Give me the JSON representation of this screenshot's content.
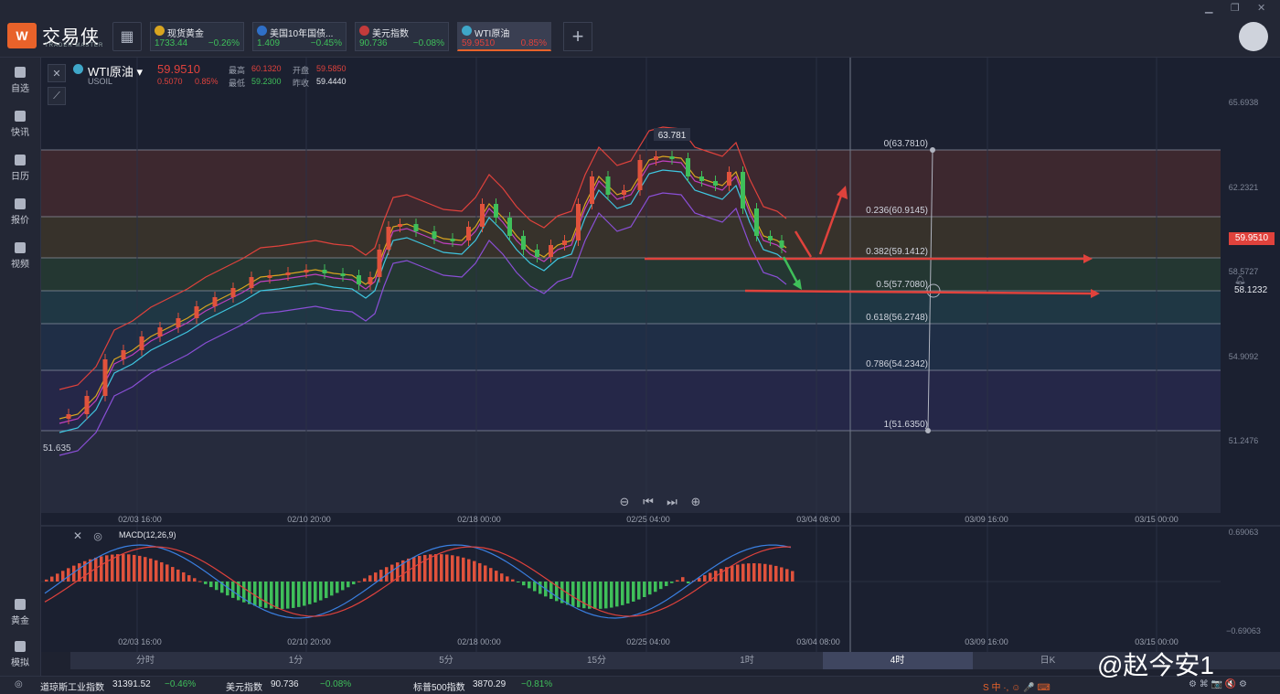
{
  "app": {
    "name": "交易侠",
    "sub": "TRADER MASTER"
  },
  "tabs": [
    {
      "name": "现货黄金",
      "price": "1733.44",
      "change": "−0.26%",
      "color": "#d9a520",
      "active": false
    },
    {
      "name": "美国10年国债...",
      "price": "1.409",
      "change": "−0.45%",
      "color": "#2f6fc7",
      "active": false
    },
    {
      "name": "美元指数",
      "price": "90.736",
      "change": "−0.08%",
      "color": "#c43b3b",
      "active": false
    },
    {
      "name": "WTI原油",
      "price": "59.9510",
      "change": "0.85%",
      "color": "#3fa7c9",
      "active": true
    }
  ],
  "sidebar": [
    {
      "label": "自选",
      "icon": "bookmark-icon"
    },
    {
      "label": "快讯",
      "icon": "news-icon"
    },
    {
      "label": "日历",
      "icon": "calendar-icon"
    },
    {
      "label": "报价",
      "icon": "quote-icon"
    },
    {
      "label": "视频",
      "icon": "video-icon"
    }
  ],
  "sidebar_bottom": [
    {
      "label": "黄金",
      "icon": "gold-icon"
    },
    {
      "label": "模拟",
      "icon": "wallet-icon"
    }
  ],
  "symbol": {
    "name": "WTI原油",
    "code": "USOIL",
    "price": "59.9510",
    "change": "0.5070",
    "change_pct": "0.85%",
    "high_label": "最高",
    "high": "60.1320",
    "open_label": "开盘",
    "open": "59.5850",
    "low_label": "最低",
    "low": "59.2300",
    "prev_label": "昨收",
    "prev": "59.4440"
  },
  "price_axis": [
    "65.6938",
    "62.2321",
    "58.5727",
    "54.9092",
    "51.2476"
  ],
  "time_axis": [
    "02/03 16:00",
    "02/10 20:00",
    "02/18 00:00",
    "02/25 04:00",
    "03/04 08:00",
    "03/09 16:00",
    "03/15 00:00"
  ],
  "fib_levels": [
    {
      "label": "0(63.7810)",
      "color": "#7a3a2e"
    },
    {
      "label": "0.236(60.9145)",
      "color": "#5e4a2a"
    },
    {
      "label": "0.382(59.1412)",
      "color": "#2e5a3a"
    },
    {
      "label": "0.5(57.7080)",
      "color": "#2a5560"
    },
    {
      "label": "0.618(56.2748)",
      "color": "#24425e"
    },
    {
      "label": "0.786(54.2342)",
      "color": "#2c3466"
    },
    {
      "label": "1(51.6350)",
      "color": "#3a3060"
    }
  ],
  "peak_label": "63.781",
  "low_label_left": "51.635",
  "current_price_tag": "59.9510",
  "alert_price": "58.1232",
  "macd": {
    "label": "MACD(12,26,9)",
    "top": "0.69063",
    "bottom": "−0.69063"
  },
  "timeframes": [
    {
      "label": "分时",
      "active": false
    },
    {
      "label": "1分",
      "active": false
    },
    {
      "label": "5分",
      "active": false
    },
    {
      "label": "15分",
      "active": false
    },
    {
      "label": "1时",
      "active": false
    },
    {
      "label": "4时",
      "active": true
    },
    {
      "label": "日K",
      "active": false
    }
  ],
  "status": {
    "dow_label": "道琼斯工业指数",
    "dow_value": "31391.52",
    "dow_change": "−0.46%",
    "usd_label": "美元指数",
    "usd_value": "90.736",
    "usd_change": "−0.08%",
    "sp_label": "标普500指数",
    "sp_value": "3870.29",
    "sp_change": "−0.81%"
  },
  "watermark": "@赵今安1"
}
